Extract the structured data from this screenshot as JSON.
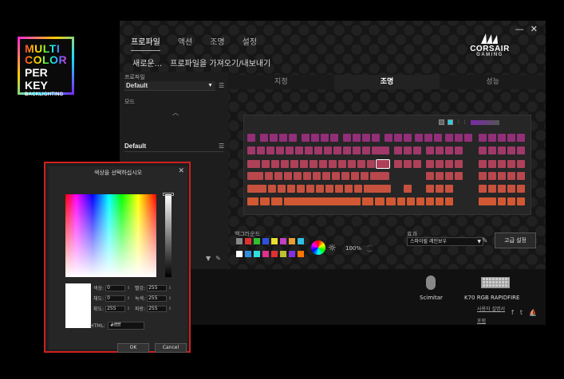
{
  "badge": {
    "line1": "MULTI COLOR",
    "line2": "PER KEY",
    "line3": "BACKLIGHTING"
  },
  "window": {
    "nav": [
      "프로파일",
      "액션",
      "조명",
      "설정"
    ],
    "sub_new": "새로운...",
    "sub_io": "프로파일을 가져오기/내보내기",
    "logo_brand": "CORSAIR",
    "logo_sub": "GAMING",
    "ctrl_min": "—",
    "ctrl_close": "✕"
  },
  "left": {
    "profile_label": "프로파일",
    "profile_value": "Default",
    "mode_label": "모드",
    "mode_value": "Default"
  },
  "right_tabs": [
    "지정",
    "조명",
    "성능"
  ],
  "lighting": {
    "bg_label": "백그라운드",
    "brightness": "100%",
    "effect_label": "효과",
    "effect_value": "스파이럴 레인보우",
    "advanced": "고급 설정",
    "palette_row1": [
      "#888888",
      "#e03030",
      "#30c030",
      "#3050e0",
      "#e8e030",
      "#c040c0",
      "#e8a030",
      "#30c0e0"
    ],
    "palette_row2": [
      "#ffffff",
      "#3090e0",
      "#30e0e0",
      "#e03090",
      "#e03030",
      "#c0c030",
      "#8030e0",
      "#ff7700"
    ]
  },
  "devices": {
    "mouse": "Scimitar",
    "keyboard": "K70 RGB RAPIDFIRE"
  },
  "links": {
    "guide": "사용자 설명서",
    "forum": "포럼"
  },
  "dialog": {
    "title": "색상을 선택하십시오",
    "hue_label": "색상:",
    "hue": "0",
    "sat_label": "채도:",
    "sat": "0",
    "lum_label": "휘도:",
    "lum": "255",
    "r_label": "빨강:",
    "r": "255",
    "g_label": "녹색:",
    "g": "255",
    "b_label": "파랑:",
    "b": "255",
    "html_label": "HTML:",
    "html": "#ffff",
    "ok": "OK",
    "cancel": "Cancel"
  },
  "colors": {
    "accent": "#d01f1f",
    "key_purple": "#8e2d7c",
    "key_orange": "#d45a2e"
  }
}
